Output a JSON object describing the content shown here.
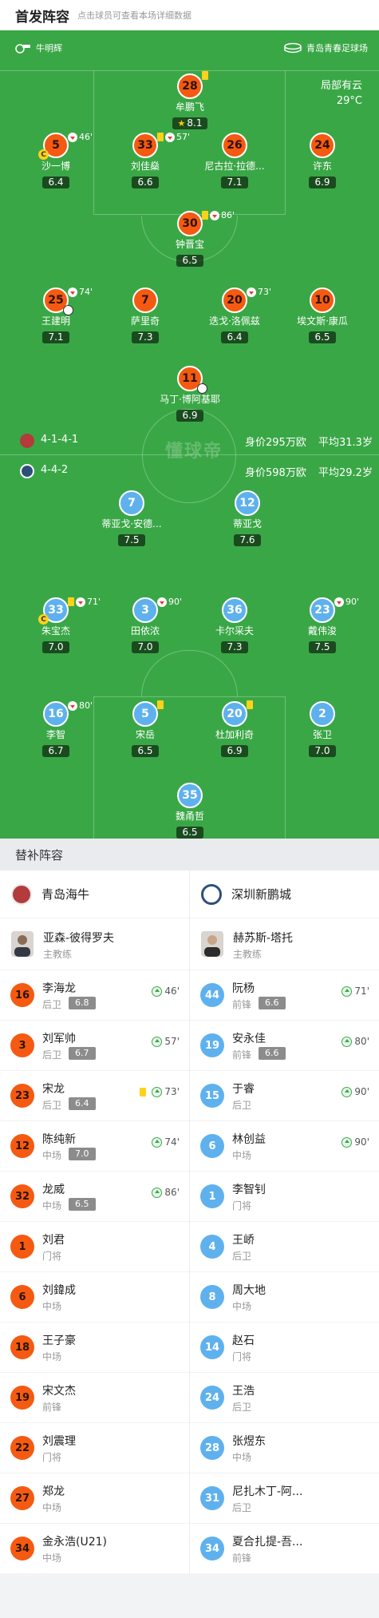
{
  "header": {
    "title": "首发阵容",
    "hint": "点击球员可查看本场详细数据"
  },
  "meta": {
    "referee": "牛明辉",
    "venue": "青岛青春足球场",
    "weather": "局部有云",
    "temperature": "29°C"
  },
  "colors": {
    "pitch": "#3aa746",
    "home": "#f55a12",
    "away": "#5fb1ee",
    "card": "#ffd21a"
  },
  "home_team": {
    "name": "青岛海牛",
    "formation": "4-1-4-1",
    "value": "身价295万欧",
    "avg_age": "平均31.3岁"
  },
  "away_team": {
    "name": "深圳新鹏城",
    "formation": "4-4-2",
    "value": "身价598万欧",
    "avg_age": "平均29.2岁"
  },
  "watermark": "懂球帝",
  "home_players": [
    {
      "num": "28",
      "name": "牟鹏飞",
      "rating": "8.1",
      "top": true,
      "yellow": true
    },
    {
      "num": "5",
      "name": "沙一博",
      "rating": "6.4",
      "sub_out": "46'",
      "captain": true
    },
    {
      "num": "33",
      "name": "刘佳燊",
      "rating": "6.6",
      "yellow": true,
      "sub_out": "57'"
    },
    {
      "num": "26",
      "name": "尼古拉·拉德...",
      "rating": "7.1"
    },
    {
      "num": "24",
      "name": "许东",
      "rating": "6.9"
    },
    {
      "num": "30",
      "name": "钟晋宝",
      "rating": "6.5",
      "yellow": true,
      "sub_out": "86'"
    },
    {
      "num": "25",
      "name": "王建明",
      "rating": "7.1",
      "sub_out": "74'",
      "goal_assist": true
    },
    {
      "num": "7",
      "name": "萨里奇",
      "rating": "7.3"
    },
    {
      "num": "20",
      "name": "迭戈·洛佩兹",
      "rating": "6.4",
      "sub_out": "73'"
    },
    {
      "num": "10",
      "name": "埃文斯·康瓜",
      "rating": "6.5"
    },
    {
      "num": "11",
      "name": "马丁·博阿基耶",
      "rating": "6.9",
      "goal": true
    }
  ],
  "away_players": [
    {
      "num": "7",
      "name": "蒂亚戈·安德...",
      "rating": "7.5"
    },
    {
      "num": "12",
      "name": "蒂亚戈",
      "rating": "7.6"
    },
    {
      "num": "33",
      "name": "朱宝杰",
      "rating": "7.0",
      "yellow": true,
      "sub_out": "71'",
      "captain": true
    },
    {
      "num": "3",
      "name": "田依浓",
      "rating": "7.0",
      "sub_out": "90'"
    },
    {
      "num": "36",
      "name": "卡尔采夫",
      "rating": "7.3"
    },
    {
      "num": "23",
      "name": "戴伟浚",
      "rating": "7.5",
      "sub_out": "90'"
    },
    {
      "num": "16",
      "name": "李智",
      "rating": "6.7",
      "sub_out": "80'"
    },
    {
      "num": "5",
      "name": "宋岳",
      "rating": "6.5",
      "yellow": true
    },
    {
      "num": "20",
      "name": "杜加利奇",
      "rating": "6.9",
      "yellow": true
    },
    {
      "num": "2",
      "name": "张卫",
      "rating": "7.0"
    },
    {
      "num": "35",
      "name": "魏甬哲",
      "rating": "6.5"
    }
  ],
  "subs": {
    "title": "替补阵容",
    "home": {
      "team": "青岛海牛",
      "coach": {
        "name": "亚森-彼得罗夫",
        "role": "主教练"
      },
      "players": [
        {
          "num": "16",
          "name": "李海龙",
          "pos": "后卫",
          "rating": "6.8",
          "minute": "46'"
        },
        {
          "num": "3",
          "name": "刘军帅",
          "pos": "后卫",
          "rating": "6.7",
          "minute": "57'"
        },
        {
          "num": "23",
          "name": "宋龙",
          "pos": "后卫",
          "rating": "6.4",
          "minute": "73'",
          "yellow": true
        },
        {
          "num": "12",
          "name": "陈纯新",
          "pos": "中场",
          "rating": "7.0",
          "minute": "74'"
        },
        {
          "num": "32",
          "name": "龙威",
          "pos": "中场",
          "rating": "6.5",
          "minute": "86'"
        },
        {
          "num": "1",
          "name": "刘君",
          "pos": "门将"
        },
        {
          "num": "6",
          "name": "刘鍏成",
          "pos": "中场"
        },
        {
          "num": "18",
          "name": "王子豪",
          "pos": "中场"
        },
        {
          "num": "19",
          "name": "宋文杰",
          "pos": "前锋"
        },
        {
          "num": "22",
          "name": "刘震理",
          "pos": "门将"
        },
        {
          "num": "27",
          "name": "郑龙",
          "pos": "中场"
        },
        {
          "num": "34",
          "name": "金永浩(U21)",
          "pos": "中场"
        }
      ]
    },
    "away": {
      "team": "深圳新鹏城",
      "coach": {
        "name": "赫苏斯-塔托",
        "role": "主教练"
      },
      "players": [
        {
          "num": "44",
          "name": "阮杨",
          "pos": "前锋",
          "rating": "6.6",
          "minute": "71'"
        },
        {
          "num": "19",
          "name": "安永佳",
          "pos": "前锋",
          "rating": "6.6",
          "minute": "80'"
        },
        {
          "num": "15",
          "name": "于睿",
          "pos": "后卫",
          "minute": "90'"
        },
        {
          "num": "6",
          "name": "林创益",
          "pos": "中场",
          "minute": "90'"
        },
        {
          "num": "1",
          "name": "李智钊",
          "pos": "门将"
        },
        {
          "num": "4",
          "name": "王峤",
          "pos": "后卫"
        },
        {
          "num": "8",
          "name": "周大地",
          "pos": "中场"
        },
        {
          "num": "14",
          "name": "赵石",
          "pos": "门将"
        },
        {
          "num": "24",
          "name": "王浩",
          "pos": "后卫"
        },
        {
          "num": "28",
          "name": "张煜东",
          "pos": "中场"
        },
        {
          "num": "31",
          "name": "尼扎木丁-阿...",
          "pos": "后卫"
        },
        {
          "num": "34",
          "name": "夏合扎提-吾...",
          "pos": "前锋"
        }
      ]
    }
  }
}
